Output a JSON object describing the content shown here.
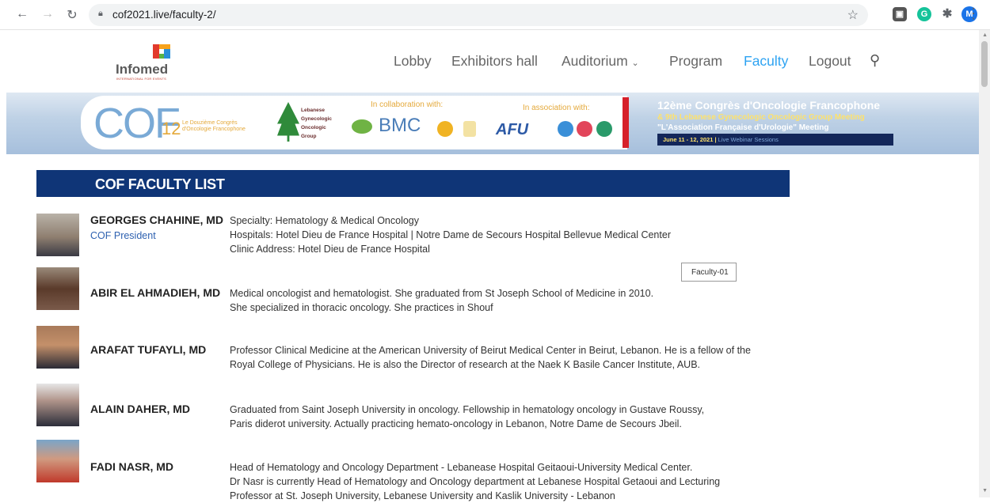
{
  "browser": {
    "url": "cof2021.live/faculty-2/",
    "profile_letter": "M"
  },
  "site": {
    "logo_text": "Infomed",
    "logo_sub": "INTERNATIONAL FOR EVENTS",
    "menu": [
      {
        "label": "Lobby"
      },
      {
        "label": "Exhibitors hall"
      },
      {
        "label": "Auditorium"
      },
      {
        "label": "Program"
      },
      {
        "label": "Faculty",
        "active": true
      },
      {
        "label": "Logout"
      }
    ]
  },
  "banner": {
    "cof": "COF",
    "cof_number": "12",
    "cof_subtitle_1": "Le Douzième Congrès",
    "cof_subtitle_2": "d'Oncologie Francophone",
    "lgog_lines": [
      "Lebanese",
      "Gynecologic",
      "Oncologic",
      "Group"
    ],
    "collab_label": "In collaboration with:",
    "assoc_label": "In association with:",
    "bmc": "BMC",
    "afu": "AFU",
    "title": "12ème Congrès d'Oncologie Francophone",
    "sub1": "& 9th Lebanese Gynecologic Oncologic Group Meeting",
    "sub2": "\"L'Association Française d'Urologie\" Meeting",
    "date": "June 11 - 12, 2021",
    "date_sub": "Live Webinar Sessions"
  },
  "faculty_list": {
    "heading": "COF FACULTY LIST",
    "tooltip": "Faculty-01",
    "members": [
      {
        "name": "GEORGES CHAHINE, MD",
        "role": "COF President",
        "lines": [
          "Specialty: Hematology & Medical Oncology",
          "Hospitals: Hotel Dieu de France Hospital | Notre Dame de Secours Hospital Bellevue Medical Center",
          "Clinic Address: Hotel Dieu de France Hospital"
        ]
      },
      {
        "name": "ABIR EL AHMADIEH, MD",
        "role": "",
        "lines": [
          "Medical oncologist and hematologist. She graduated from St Joseph School of Medicine in 2010.",
          "She specialized in thoracic oncology. She practices in Shouf"
        ]
      },
      {
        "name": "ARAFAT TUFAYLI, MD",
        "role": "",
        "lines": [
          "Professor Clinical Medicine at the American University of Beirut Medical Center in Beirut, Lebanon. He is a fellow of the",
          "Royal College of Physicians. He is also the Director of research at the Naek K Basile Cancer Institute, AUB."
        ]
      },
      {
        "name": "ALAIN DAHER, MD",
        "role": "",
        "lines": [
          "Graduated from Saint Joseph University in oncology. Fellowship in hematology oncology in Gustave Roussy,",
          "Paris diderot university. Actually practicing hemato-oncology in Lebanon, Notre Dame de Secours Jbeil."
        ]
      },
      {
        "name": "FADI NASR, MD",
        "role": "",
        "lines": [
          "Head of Hematology and Oncology Department - Lebanease Hospital  Geitaoui-University Medical Center.",
          "Dr Nasr is currently Head of Hematology and Oncology department at Lebanese Hospital Getaoui and Lecturing",
          "Professor at St. Joseph University, Lebanese University and Kaslik University - Lebanon"
        ]
      }
    ]
  }
}
